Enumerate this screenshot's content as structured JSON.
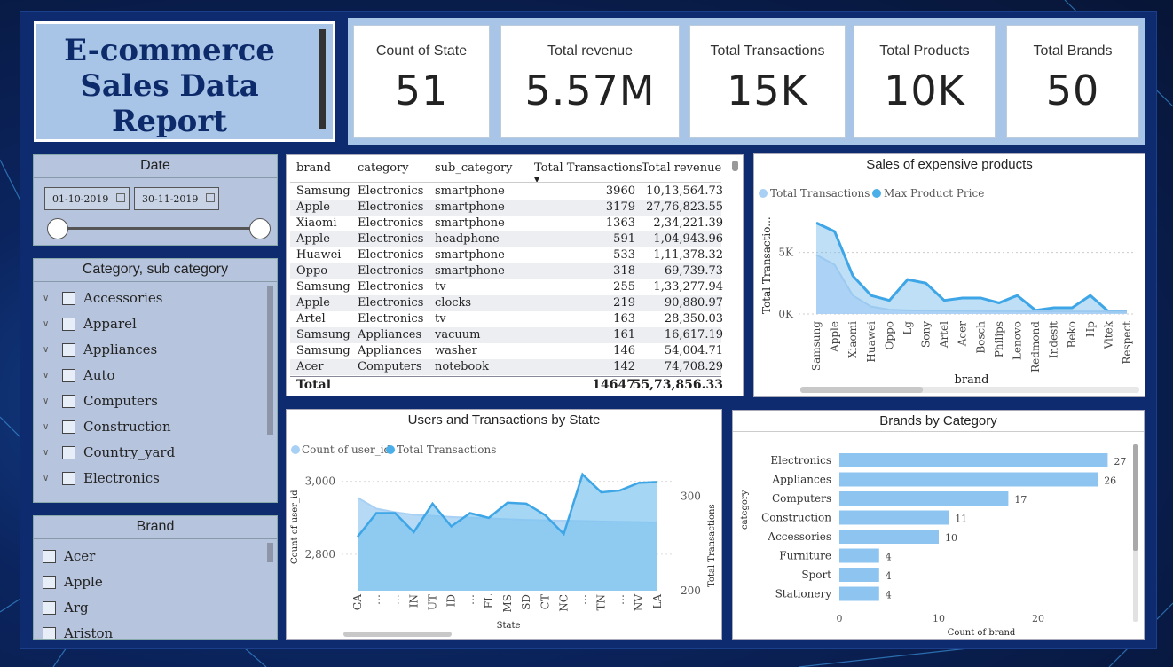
{
  "title": "E-commerce Sales Data Report",
  "kpis": [
    {
      "label": "Count of State",
      "value": "51"
    },
    {
      "label": "Total revenue",
      "value": "5.57M"
    },
    {
      "label": "Total Transactions",
      "value": "15K"
    },
    {
      "label": "Total Products",
      "value": "10K"
    },
    {
      "label": "Total Brands",
      "value": "50"
    }
  ],
  "date_slicer": {
    "header": "Date",
    "start": "01-10-2019",
    "end": "30-11-2019"
  },
  "category_slicer": {
    "header": "Category, sub category",
    "items": [
      "Accessories",
      "Apparel",
      "Appliances",
      "Auto",
      "Computers",
      "Construction",
      "Country_yard",
      "Electronics"
    ]
  },
  "brand_slicer": {
    "header": "Brand",
    "items": [
      "Acer",
      "Apple",
      "Arg",
      "Ariston"
    ]
  },
  "table": {
    "columns": [
      "brand",
      "category",
      "sub_category",
      "Total Transactions",
      "Total revenue"
    ],
    "rows": [
      [
        "Samsung",
        "Electronics",
        "smartphone",
        "3960",
        "10,13,564.73"
      ],
      [
        "Apple",
        "Electronics",
        "smartphone",
        "3179",
        "27,76,823.55"
      ],
      [
        "Xiaomi",
        "Electronics",
        "smartphone",
        "1363",
        "2,34,221.39"
      ],
      [
        "Apple",
        "Electronics",
        "headphone",
        "591",
        "1,04,943.96"
      ],
      [
        "Huawei",
        "Electronics",
        "smartphone",
        "533",
        "1,11,378.32"
      ],
      [
        "Oppo",
        "Electronics",
        "smartphone",
        "318",
        "69,739.73"
      ],
      [
        "Samsung",
        "Electronics",
        "tv",
        "255",
        "1,33,277.94"
      ],
      [
        "Apple",
        "Electronics",
        "clocks",
        "219",
        "90,880.97"
      ],
      [
        "Artel",
        "Electronics",
        "tv",
        "163",
        "28,350.03"
      ],
      [
        "Samsung",
        "Appliances",
        "vacuum",
        "161",
        "16,617.19"
      ],
      [
        "Samsung",
        "Appliances",
        "washer",
        "146",
        "54,004.71"
      ],
      [
        "Acer",
        "Computers",
        "notebook",
        "142",
        "74,708.29"
      ]
    ],
    "total": [
      "Total",
      "14647",
      "55,73,856.33"
    ]
  },
  "sales_chart": {
    "title": "Sales of expensive products",
    "legend": [
      "Total Transactions",
      "Max Product Price"
    ],
    "ylabel": "Total Transactio...",
    "xlabel": "brand",
    "yticks": [
      "5K",
      "0K"
    ],
    "colors": {
      "series1": "#a8d0f5",
      "series2": "#4aaee8"
    }
  },
  "users_chart": {
    "title": "Users and Transactions by State",
    "legend": [
      "Count of user_id",
      "Total Transactions"
    ],
    "ylabel_left": "Count of user_id",
    "ylabel_right": "Total Transactions",
    "xlabel": "State",
    "yticks_left": [
      "3,000",
      "2,800"
    ],
    "yticks_right": [
      "300",
      "200"
    ]
  },
  "brands_chart": {
    "title": "Brands by Category",
    "ylabel": "category",
    "xlabel": "Count of brand",
    "xticks": [
      "0",
      "10",
      "20"
    ],
    "color": "#8ec5f0"
  },
  "chart_data": [
    {
      "type": "area",
      "title": "Sales of expensive products",
      "categories": [
        "Samsung",
        "Apple",
        "Xiaomi",
        "Huawei",
        "Oppo",
        "Lg",
        "Sony",
        "Artel",
        "Acer",
        "Bosch",
        "Philips",
        "Lenovo",
        "Redmond",
        "Indesit",
        "Beko",
        "Hp",
        "Vitek",
        "Respect"
      ],
      "series": [
        {
          "name": "Total Transactions",
          "values": [
            4800,
            4000,
            1500,
            600,
            350,
            300,
            280,
            260,
            250,
            240,
            230,
            230,
            220,
            220,
            210,
            210,
            200,
            200
          ]
        },
        {
          "name": "Max Product Price",
          "values": [
            7400,
            6700,
            3100,
            1500,
            1100,
            2800,
            2500,
            1100,
            1300,
            1300,
            900,
            1500,
            300,
            500,
            500,
            1500,
            200,
            200
          ]
        }
      ],
      "xlabel": "brand",
      "ylabel": "Total Transactio...",
      "ylim": [
        0,
        8500
      ]
    },
    {
      "type": "area",
      "title": "Users and Transactions by State",
      "categories": [
        "GA",
        "…",
        "…",
        "IN",
        "UT",
        "ID",
        "…",
        "FL",
        "MS",
        "SD",
        "CT",
        "NC",
        "…",
        "TN",
        "…",
        "NV",
        "LA"
      ],
      "series": [
        {
          "name": "Count of user_id",
          "axis": "left",
          "values": [
            2955,
            2925,
            2915,
            2908,
            2905,
            2902,
            2900,
            2898,
            2896,
            2894,
            2893,
            2892,
            2891,
            2890,
            2889,
            2888,
            2887
          ]
        },
        {
          "name": "Total Transactions",
          "axis": "right",
          "values": [
            257,
            282,
            282,
            262,
            292,
            268,
            282,
            277,
            293,
            292,
            280,
            260,
            323,
            304,
            306,
            314,
            315
          ]
        }
      ],
      "xlabel": "State",
      "ylim_left": [
        2700,
        3050
      ],
      "ylim_right": [
        200,
        335
      ]
    },
    {
      "type": "bar",
      "title": "Brands by Category",
      "categories": [
        "Electronics",
        "Appliances",
        "Computers",
        "Construction",
        "Accessories",
        "Furniture",
        "Sport",
        "Stationery"
      ],
      "values": [
        27,
        26,
        17,
        11,
        10,
        4,
        4,
        4
      ],
      "xlabel": "Count of brand",
      "ylabel": "category",
      "xlim": [
        0,
        30
      ]
    }
  ]
}
